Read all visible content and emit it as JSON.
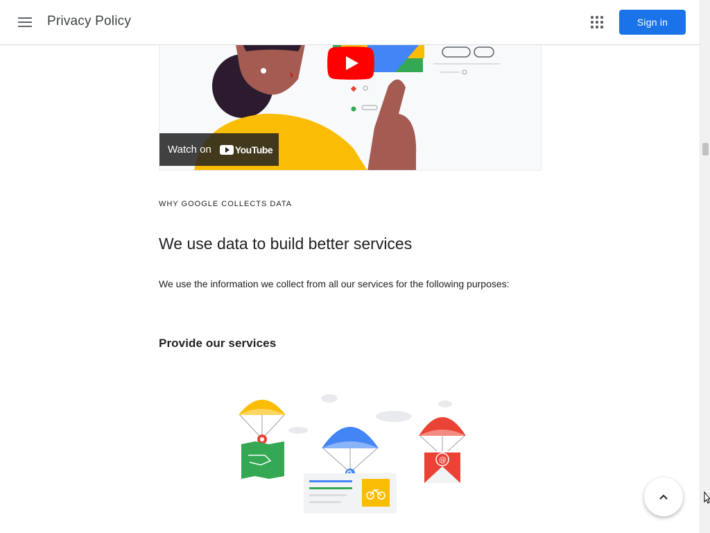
{
  "header": {
    "title": "Privacy Policy",
    "signin_label": "Sign in"
  },
  "video": {
    "watch_label": "Watch on",
    "platform_label": "YouTube"
  },
  "section": {
    "eyebrow": "WHY GOOGLE COLLECTS DATA",
    "heading": "We use data to build better services",
    "intro": "We use the information we collect from all our services for the following purposes:",
    "subheading": "Provide our services"
  },
  "icons": {
    "menu": "hamburger-menu-icon",
    "apps": "apps-grid-icon",
    "play": "youtube-play-icon",
    "back_to_top": "chevron-up-icon"
  },
  "colors": {
    "accent": "#1a73e8",
    "youtube_red": "#ff0000",
    "text": "#202124"
  }
}
